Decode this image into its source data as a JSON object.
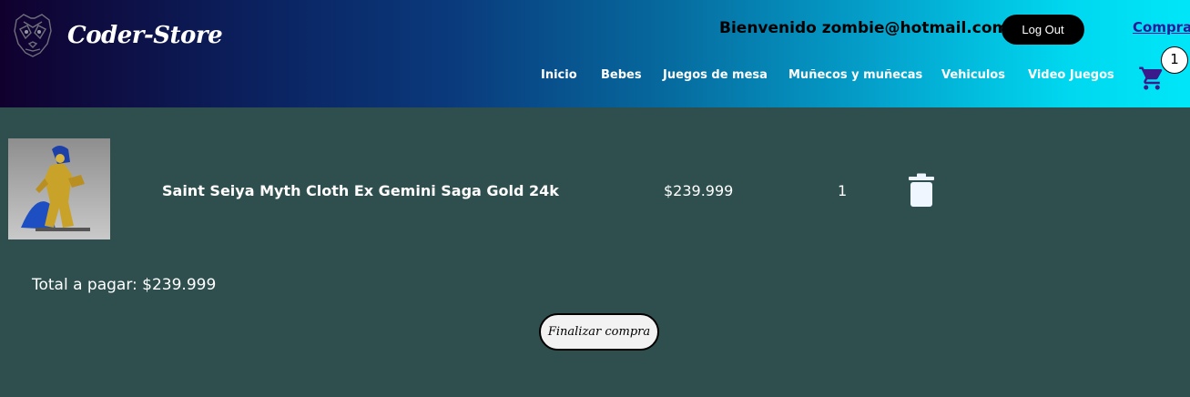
{
  "brand": {
    "name": "Coder-Store",
    "logo_icon": "panda-icon"
  },
  "header": {
    "welcome": "Bienvenido zombie@hotmail.com",
    "logout_label": "Log Out",
    "compras_link": "Compras"
  },
  "nav": {
    "items": [
      {
        "label": "Inicio"
      },
      {
        "label": "Bebes"
      },
      {
        "label": "Juegos de mesa"
      },
      {
        "label": "Muñecos y muñecas"
      },
      {
        "label": "Vehiculos"
      },
      {
        "label": "Video Juegos"
      }
    ],
    "cart_icon": "cart-icon",
    "cart_count": "1"
  },
  "cart": {
    "items": [
      {
        "name": "Saint Seiya Myth Cloth Ex Gemini Saga Gold 24k",
        "price": "$239.999",
        "quantity": "1",
        "delete_icon": "trash-icon"
      }
    ],
    "total": "Total a pagar: $239.999",
    "finalize_label": "Finalizar compra"
  },
  "colors": {
    "page_background": "#2f4f4f",
    "cart_icon": "#3b1a8c",
    "compras_link": "#2a1a9a"
  }
}
